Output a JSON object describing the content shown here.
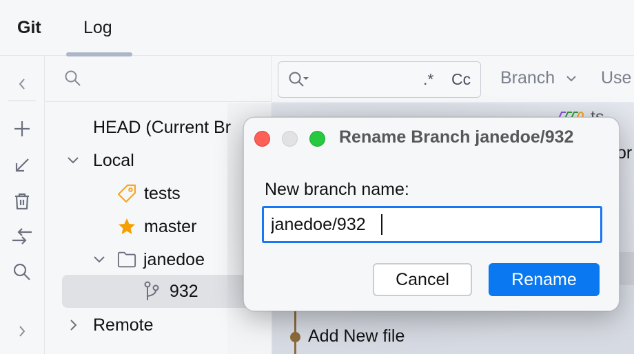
{
  "topbar": {
    "tabs": [
      {
        "label": "Git",
        "active": false
      },
      {
        "label": "Log",
        "active": true
      }
    ]
  },
  "toolbar": {
    "icons": [
      "chevron-left-icon",
      "plus-icon",
      "arrow-down-left-icon",
      "trash-icon",
      "compare-arrows-icon",
      "search-icon",
      "chevron-right-icon"
    ]
  },
  "tree": {
    "search_placeholder": "",
    "rows": [
      {
        "label": "HEAD (Current Branch)",
        "visible_label": "HEAD (Current Br",
        "icon": "",
        "expand": ""
      },
      {
        "label": "Local",
        "icon": "",
        "expand": "expanded"
      },
      {
        "label": "tests",
        "icon": "tag-icon",
        "expand": ""
      },
      {
        "label": "master",
        "icon": "star-icon",
        "expand": ""
      },
      {
        "label": "janedoe",
        "icon": "folder-icon",
        "expand": "expanded"
      },
      {
        "label": "932",
        "icon": "branch-icon",
        "expand": "",
        "selected": true
      },
      {
        "label": "Remote",
        "icon": "",
        "expand": "collapsed"
      }
    ]
  },
  "log": {
    "search": {
      "value": "",
      "regex_label": ".*",
      "case_label": "Cc"
    },
    "filters": [
      {
        "label": "Branch"
      },
      {
        "label": "Use"
      }
    ],
    "visible_tag": "ts",
    "visible_peek": "or",
    "commits": [
      {
        "message": "Add New file"
      }
    ]
  },
  "dialog": {
    "title": "Rename Branch janedoe/932",
    "field_label": "New branch name:",
    "field_value": "janedoe/932",
    "cancel_label": "Cancel",
    "rename_label": "Rename"
  },
  "colors": {
    "accent": "#0a78f0",
    "focus_border": "#1877f2",
    "tag_icon": "#f5a623",
    "star_icon": "#f5a000",
    "graph": "#8d6b3a",
    "traffic_close": "#fe5f57",
    "traffic_min": "#e2e2e4",
    "traffic_max": "#28c840"
  }
}
